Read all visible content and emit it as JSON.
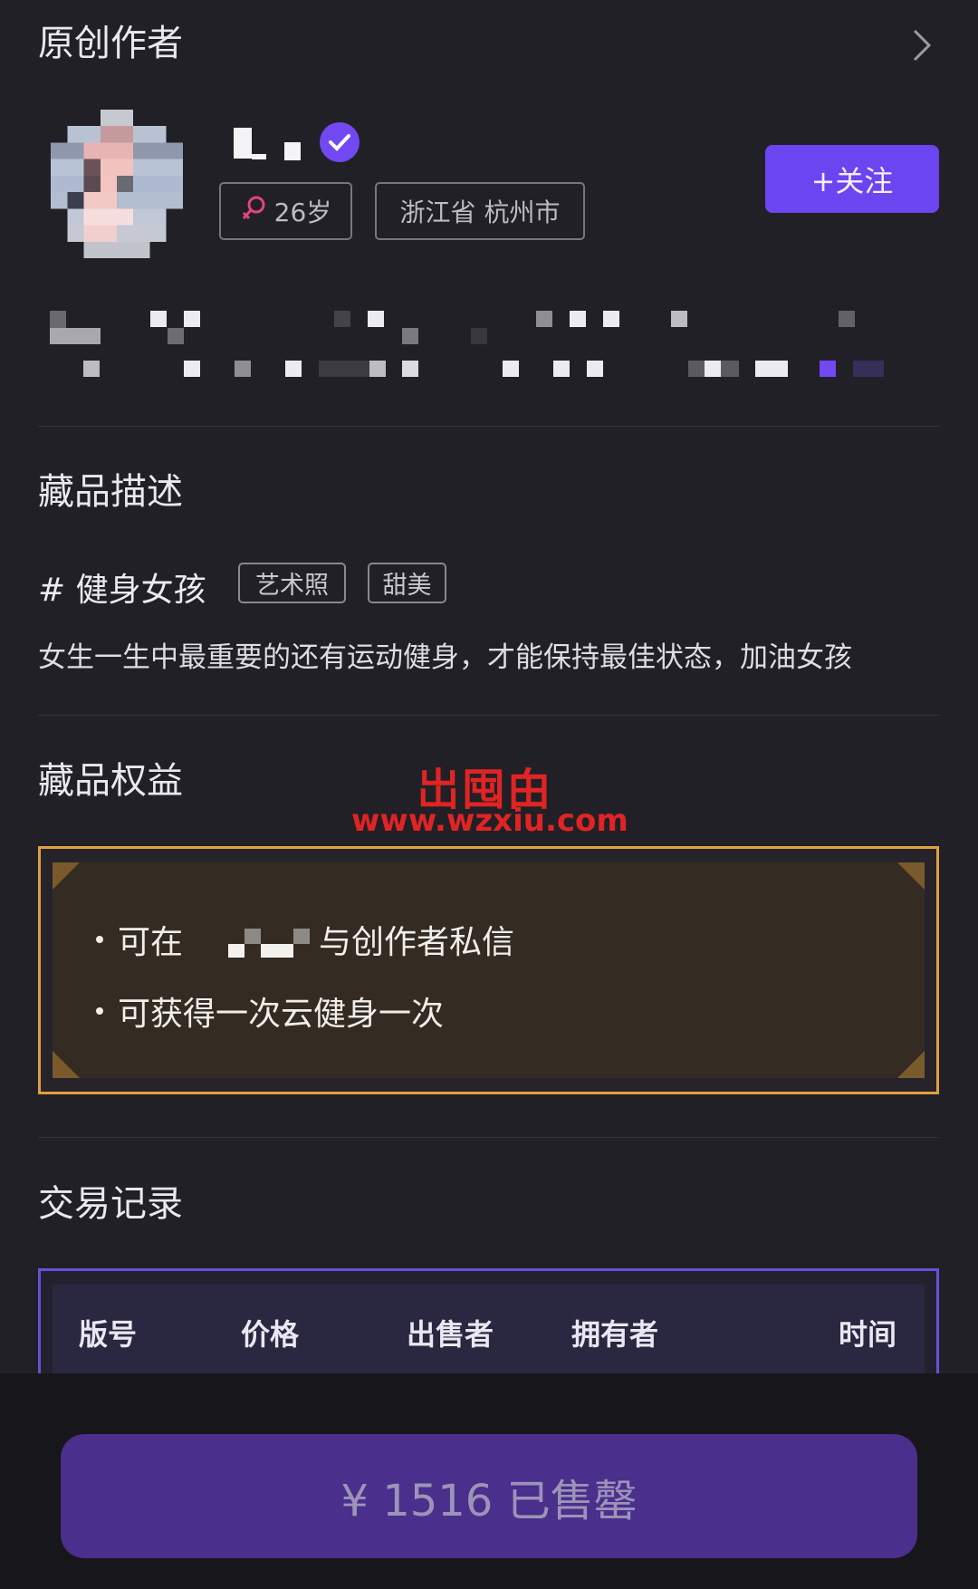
{
  "creator_section": {
    "title": "原创作者",
    "arrow_icon": "chevron-right-icon"
  },
  "creator": {
    "verified_icon": "verified-badge-icon",
    "gender_icon": "female-icon",
    "age": "26岁",
    "location": "浙江省 杭州市",
    "follow_label": "+关注"
  },
  "description_section": {
    "title": "藏品描述",
    "hashtag": "# 健身女孩",
    "tags": [
      "艺术照",
      "甜美"
    ],
    "text": "女生一生中最重要的还有运动健身，才能保持最佳状态，加油女孩"
  },
  "benefits_section": {
    "title": "藏品权益",
    "items": [
      {
        "prefix": "可在",
        "suffix": "与创作者私信"
      },
      {
        "prefix": "可获得一次云健身一次",
        "suffix": ""
      }
    ]
  },
  "watermark": {
    "logo": "岀囤甶",
    "url": "www.wzxiu.com"
  },
  "trade_section": {
    "title": "交易记录",
    "columns": [
      "版号",
      "价格",
      "出售者",
      "拥有者",
      "时间"
    ]
  },
  "buy_button": {
    "label": "¥ 1516 已售罄"
  },
  "colors": {
    "accent": "#6b45f0",
    "gold_border": "#e0a040",
    "sold_out_button": "#4a2f8c",
    "background": "#212026"
  }
}
